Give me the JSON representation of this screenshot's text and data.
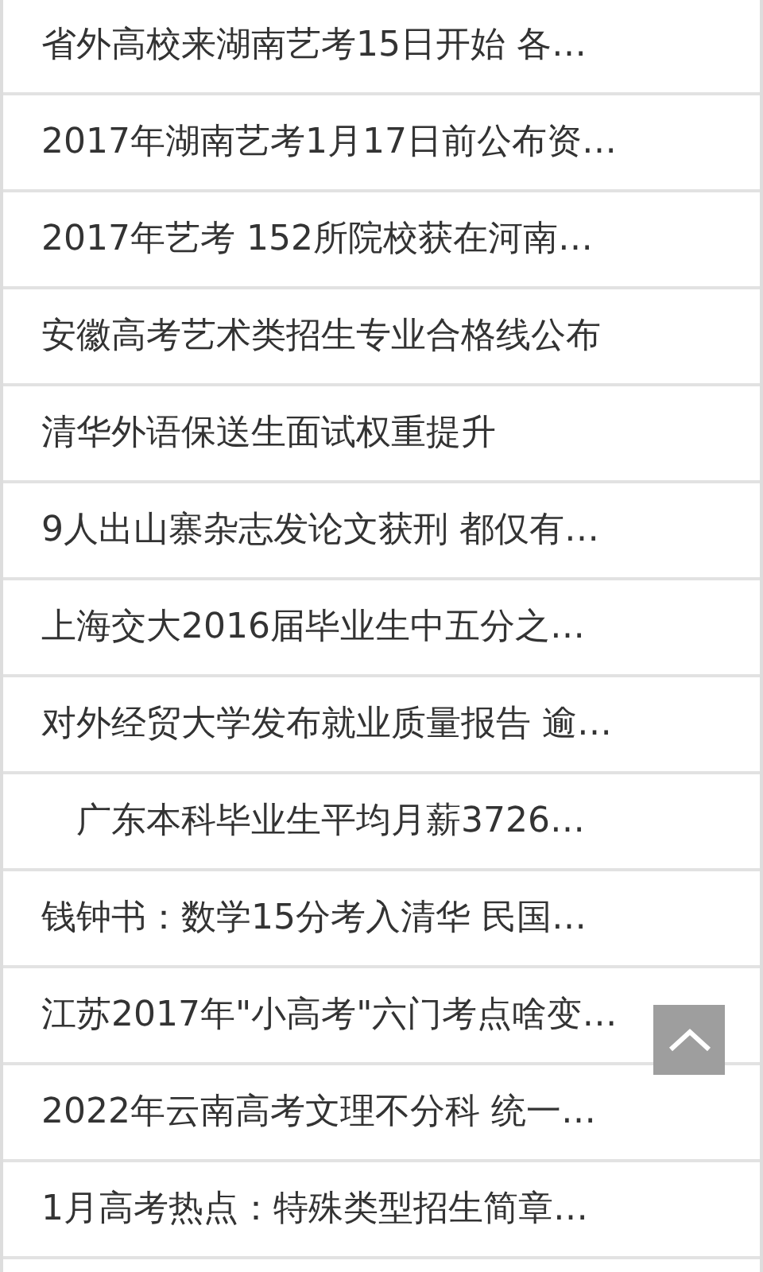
{
  "news_items": [
    {
      "title": "省外高校来湖南艺考15日开始 各…"
    },
    {
      "title": "2017年湖南艺考1月17日前公布资…"
    },
    {
      "title": "2017年艺考 152所院校获在河南…"
    },
    {
      "title": "安徽高考艺术类招生专业合格线公布"
    },
    {
      "title": "清华外语保送生面试权重提升"
    },
    {
      "title": "9人出山寨杂志发论文获刑 都仅有…"
    },
    {
      "title": "上海交大2016届毕业生中五分之…"
    },
    {
      "title": "对外经贸大学发布就业质量报告 逾…"
    },
    {
      "title": "　广东本科毕业生平均月薪3726…"
    },
    {
      "title": "钱钟书：数学15分考入清华 民国…"
    },
    {
      "title": "江苏2017年\"小高考\"六门考点啥变…"
    },
    {
      "title": "2022年云南高考文理不分科 统一…"
    },
    {
      "title": "1月高考热点：特殊类型招生简章…"
    }
  ]
}
